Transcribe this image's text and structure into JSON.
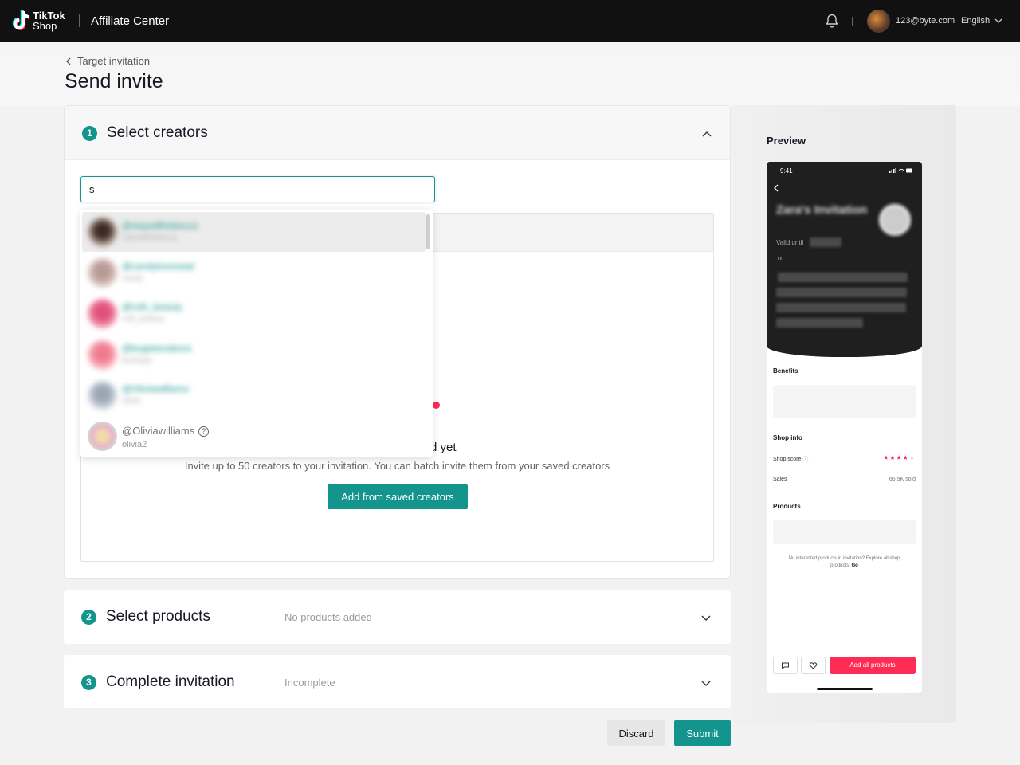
{
  "topbar": {
    "logo_line1": "TikTok",
    "logo_line2": "Shop",
    "app_title": "Affiliate Center",
    "email": "123@byte.com",
    "language": "English"
  },
  "header": {
    "back_label": "Target invitation",
    "page_title": "Send invite"
  },
  "steps": [
    {
      "number": "1",
      "title": "Select creators",
      "status": ""
    },
    {
      "number": "2",
      "title": "Select products",
      "status": "No products added"
    },
    {
      "number": "3",
      "title": "Complete invitation",
      "status": "Incomplete"
    }
  ],
  "search": {
    "value": "s",
    "placeholder": ""
  },
  "dropdown": {
    "items": [
      {
        "name": "@stayw8hebecca",
        "handle": "stayw8hebecca",
        "blurred": true
      },
      {
        "name": "@candyloveswat",
        "handle": "candy",
        "blurred": true
      },
      {
        "name": "@ruth_beauty",
        "handle": "ruth_beauty",
        "blurred": true
      },
      {
        "name": "@bugeborabora",
        "handle": "bostings",
        "blurred": true
      },
      {
        "name": "@Oliviawilliams",
        "handle": "olivia",
        "blurred": true
      },
      {
        "name": "@Oliviawilliams",
        "handle": "olivia2",
        "blurred": false
      }
    ]
  },
  "empty_state": {
    "title_tail": "d yet",
    "description": "Invite up to 50 creators to your invitation. You can batch invite them from your saved creators",
    "button": "Add from saved creators"
  },
  "actions": {
    "discard": "Discard",
    "submit": "Submit"
  },
  "preview": {
    "label": "Preview",
    "time": "9:41",
    "invitation_title": "Zara's Invitation",
    "valid_until_label": "Valid until",
    "quote_mark": "\"",
    "benefits_label": "Benefits",
    "shop_info_label": "Shop info",
    "shop_score_label": "Shop score",
    "sales_label": "Sales",
    "sales_value": "66.5K sold",
    "products_label": "Products",
    "products_note": "No interested products in invitation? Explore all shop products.",
    "products_note_link": "Go",
    "add_all_button": "Add all products",
    "shop_rating": 4,
    "shop_rating_max": 5
  },
  "colors": {
    "accent": "#13948d",
    "brand_red": "#fe2c55",
    "topbar": "#111111"
  }
}
